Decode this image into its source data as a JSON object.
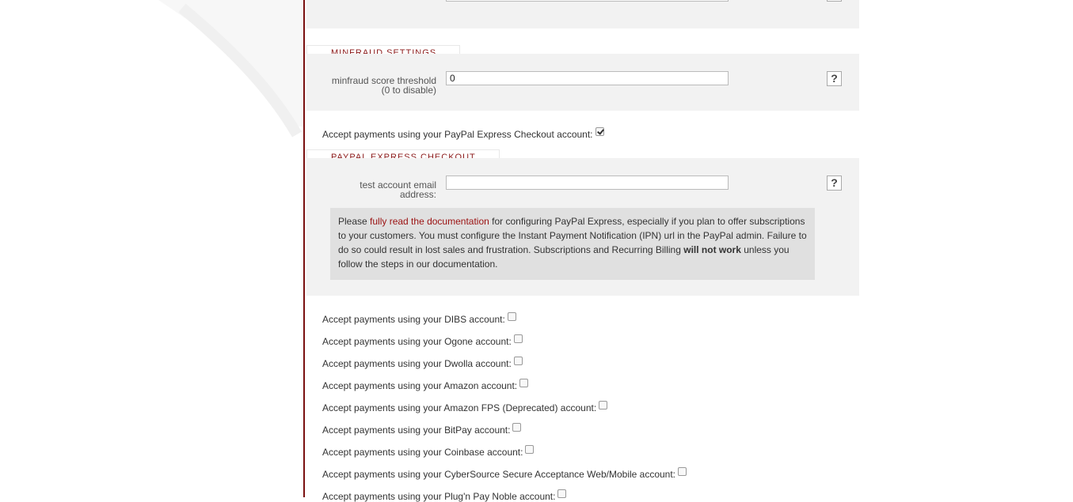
{
  "minfraud": {
    "legend": "MINFRAUD SETTINGS",
    "threshold_label_line1": "minfraud score threshold",
    "threshold_label_line2": "(0 to disable)",
    "threshold_value": "0",
    "help_label": "?"
  },
  "paypal_express": {
    "accept_label": "Accept payments using your PayPal Express Checkout account:",
    "checked": true,
    "legend": "PAYPAL EXPRESS CHECKOUT",
    "email_label_line1": "test account email",
    "email_label_line2": "address:",
    "email_value": "",
    "help_label": "?",
    "note_prefix": "Please ",
    "note_link": "fully read the documentation",
    "note_middle": " for configuring PayPal Express, especially if you plan to offer subscriptions to your customers. You must configure the Instant Payment Notification (IPN) url in the PayPal admin. Failure to do so could result in lost sales and frustration. Subscriptions and Recurring Billing ",
    "note_bold": "will not work",
    "note_suffix": " unless you follow the steps in our documentation."
  },
  "accounts": [
    {
      "label": "Accept payments using your DIBS account:",
      "checked": false
    },
    {
      "label": "Accept payments using your Ogone account:",
      "checked": false
    },
    {
      "label": "Accept payments using your Dwolla account:",
      "checked": false
    },
    {
      "label": "Accept payments using your Amazon account:",
      "checked": false
    },
    {
      "label": "Accept payments using your Amazon FPS (Deprecated) account:",
      "checked": false
    },
    {
      "label": "Accept payments using your BitPay account:",
      "checked": false
    },
    {
      "label": "Accept payments using your Coinbase account:",
      "checked": false
    },
    {
      "label": "Accept payments using your CyberSource Secure Acceptance Web/Mobile account:",
      "checked": false
    },
    {
      "label": "Accept payments using your Plug'n Pay Noble account:",
      "checked": false
    }
  ]
}
